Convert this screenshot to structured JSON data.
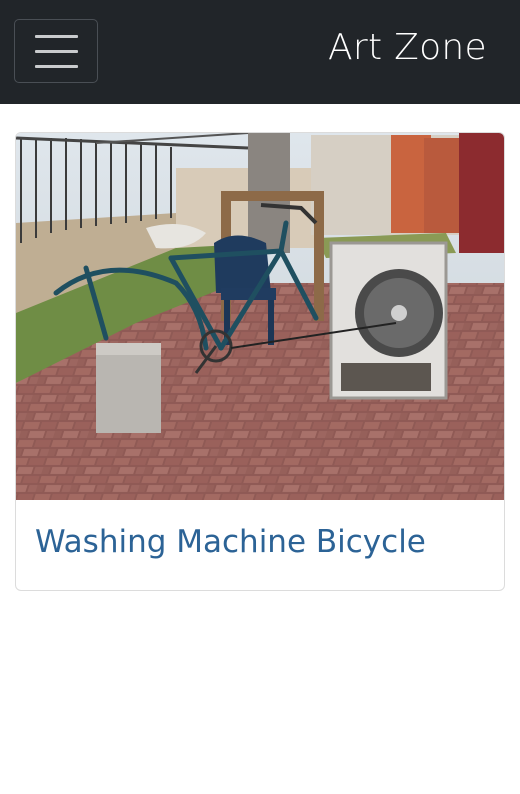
{
  "navbar": {
    "toggle_icon": "hamburger-menu-icon",
    "brand": "Art Zone"
  },
  "cards": [
    {
      "image_subject": "washing-machine-bicycle-photo",
      "title": "Washing Machine Bicycle"
    }
  ],
  "colors": {
    "navbar_bg": "#212529",
    "title_link": "#2c6396"
  }
}
